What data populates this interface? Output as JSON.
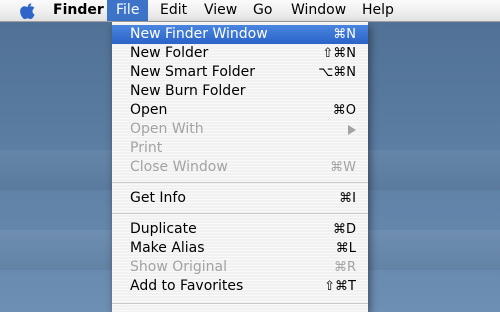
{
  "menubar": {
    "items": [
      {
        "label": "Finder"
      },
      {
        "label": "File"
      },
      {
        "label": "Edit"
      },
      {
        "label": "View"
      },
      {
        "label": "Go"
      },
      {
        "label": "Window"
      },
      {
        "label": "Help"
      }
    ]
  },
  "file_menu": {
    "items": [
      {
        "label": "New Finder Window",
        "shortcut": "⌘N",
        "enabled": true,
        "selected": true
      },
      {
        "label": "New Folder",
        "shortcut": "⇧⌘N",
        "enabled": true
      },
      {
        "label": "New Smart Folder",
        "shortcut": "⌥⌘N",
        "enabled": true
      },
      {
        "label": "New Burn Folder",
        "shortcut": "",
        "enabled": true
      },
      {
        "label": "Open",
        "shortcut": "⌘O",
        "enabled": true
      },
      {
        "label": "Open With",
        "shortcut": "",
        "enabled": false,
        "submenu": true
      },
      {
        "label": "Print",
        "shortcut": "",
        "enabled": false
      },
      {
        "label": "Close Window",
        "shortcut": "⌘W",
        "enabled": false
      },
      {
        "label": "Get Info",
        "shortcut": "⌘I",
        "enabled": true
      },
      {
        "label": "Duplicate",
        "shortcut": "⌘D",
        "enabled": true
      },
      {
        "label": "Make Alias",
        "shortcut": "⌘L",
        "enabled": true
      },
      {
        "label": "Show Original",
        "shortcut": "⌘R",
        "enabled": false
      },
      {
        "label": "Add to Favorites",
        "shortcut": "⇧⌘T",
        "enabled": true
      }
    ]
  },
  "icons": {
    "apple": "apple-logo-icon",
    "submenu": "chevron-right-icon"
  },
  "colors": {
    "highlight": "#3d74c9",
    "desktop": "#5b7da2",
    "disabled_text": "#a3a3a3"
  }
}
